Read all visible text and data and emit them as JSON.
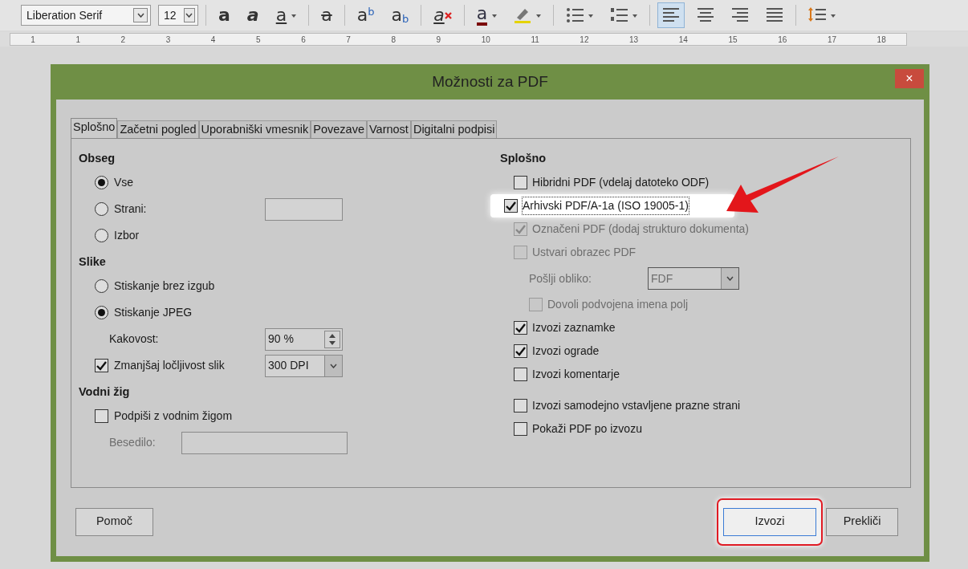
{
  "toolbar": {
    "font_name": "Liberation Serif",
    "font_size": "12",
    "buttons": [
      {
        "kind": "bold",
        "glyph": "a",
        "dropdown": false,
        "selected": false
      },
      {
        "kind": "italic",
        "glyph": "a",
        "dropdown": false,
        "selected": false
      },
      {
        "kind": "underline",
        "glyph": "a",
        "dropdown": true,
        "selected": false
      },
      {
        "kind": "strike",
        "glyph": "a",
        "dropdown": false,
        "selected": false
      },
      {
        "kind": "super",
        "glyph": "a",
        "sub": "b",
        "dropdown": false,
        "selected": false
      },
      {
        "kind": "subscript",
        "glyph": "a",
        "sub": "b",
        "dropdown": false,
        "selected": false
      },
      {
        "kind": "clear",
        "glyph": "a",
        "dropdown": false,
        "selected": false
      },
      {
        "kind": "fontcolor",
        "glyph": "a",
        "dropdown": true,
        "selected": false
      },
      {
        "kind": "highlight",
        "dropdown": true,
        "selected": false
      },
      {
        "kind": "bullets",
        "dropdown": true,
        "selected": false
      },
      {
        "kind": "numbering",
        "dropdown": true,
        "selected": false
      },
      {
        "kind": "align-left",
        "dropdown": false,
        "selected": true
      },
      {
        "kind": "align-center",
        "dropdown": false,
        "selected": false
      },
      {
        "kind": "align-right",
        "dropdown": false,
        "selected": false
      },
      {
        "kind": "justify",
        "dropdown": false,
        "selected": false
      },
      {
        "kind": "spacing",
        "dropdown": true,
        "selected": false
      }
    ]
  },
  "ruler": [
    "1",
    "1",
    "2",
    "3",
    "4",
    "5",
    "6",
    "7",
    "8",
    "9",
    "10",
    "11",
    "12",
    "13",
    "14",
    "15",
    "16",
    "17",
    "18"
  ],
  "dialog": {
    "title": "Možnosti za PDF",
    "close": "×",
    "tabs": [
      {
        "label": "Splošno",
        "selected": true
      },
      {
        "label": "Začetni pogled",
        "selected": false
      },
      {
        "label": "Uporabniški vmesnik",
        "selected": false
      },
      {
        "label": "Povezave",
        "selected": false
      },
      {
        "label": "Varnost",
        "selected": false
      },
      {
        "label": "Digitalni podpisi",
        "selected": false
      }
    ],
    "left": [
      {
        "heading": "Obseg",
        "items": [
          {
            "kind": "radio",
            "label": "Vse",
            "selected": true
          },
          {
            "kind": "radio",
            "label": "Strani:",
            "selected": false,
            "field": {
              "kind": "text"
            }
          },
          {
            "kind": "radio",
            "label": "Izbor",
            "selected": false
          }
        ]
      },
      {
        "heading": "Slike",
        "items": [
          {
            "kind": "radio",
            "label": "Stiskanje brez izgub",
            "selected": false
          },
          {
            "kind": "radio",
            "label": "Stiskanje JPEG",
            "selected": true
          },
          {
            "kind": "label",
            "label": "Kakovost:",
            "field": {
              "kind": "spin",
              "value": "90 %"
            }
          },
          {
            "kind": "checkbox",
            "label": "Zmanjšaj ločljivost slik",
            "checked": true,
            "field": {
              "kind": "select",
              "value": "300 DPI"
            }
          }
        ]
      },
      {
        "heading": "Vodni žig",
        "items": [
          {
            "kind": "checkbox",
            "label": "Podpiši z vodnim žigom",
            "checked": false
          },
          {
            "kind": "label",
            "label": "Besedilo:",
            "disabled": true,
            "field": {
              "kind": "text",
              "disabled": true
            }
          }
        ]
      }
    ],
    "right": {
      "heading": "Splošno",
      "groups": [
        {
          "items": [
            {
              "kind": "checkbox",
              "label": "Hibridni PDF (vdelaj datoteko ODF)",
              "checked": false
            },
            {
              "kind": "checkbox",
              "label": "Arhivski PDF/A-1a (ISO 19005-1)",
              "checked": true,
              "highlighted": true
            },
            {
              "kind": "checkbox",
              "label": "Označeni PDF (dodaj strukturo dokumenta)",
              "checked": true,
              "disabled": true
            },
            {
              "kind": "checkbox",
              "label": "Ustvari obrazec PDF",
              "checked": false,
              "disabled": true,
              "children": [
                {
                  "kind": "select",
                  "label": "Pošlji obliko:",
                  "value": "FDF",
                  "disabled": true
                },
                {
                  "kind": "checkbox",
                  "label": "Dovoli podvojena imena polj",
                  "checked": false,
                  "disabled": true
                }
              ]
            },
            {
              "kind": "checkbox",
              "label": "Izvozi zaznamke",
              "checked": true
            },
            {
              "kind": "checkbox",
              "label": "Izvozi ograde",
              "checked": true
            },
            {
              "kind": "checkbox",
              "label": "Izvozi komentarje",
              "checked": false
            }
          ]
        },
        {
          "items": [
            {
              "kind": "checkbox",
              "label": "Izvozi samodejno vstavljene prazne strani",
              "checked": false
            },
            {
              "kind": "checkbox",
              "label": "Pokaži PDF po izvozu",
              "checked": false
            }
          ]
        }
      ]
    },
    "buttons": [
      {
        "label": "Pomoč",
        "kind": "help"
      },
      {
        "label": "Izvozi",
        "kind": "default",
        "highlighted": true
      },
      {
        "label": "Prekliči",
        "kind": "cancel"
      }
    ]
  }
}
